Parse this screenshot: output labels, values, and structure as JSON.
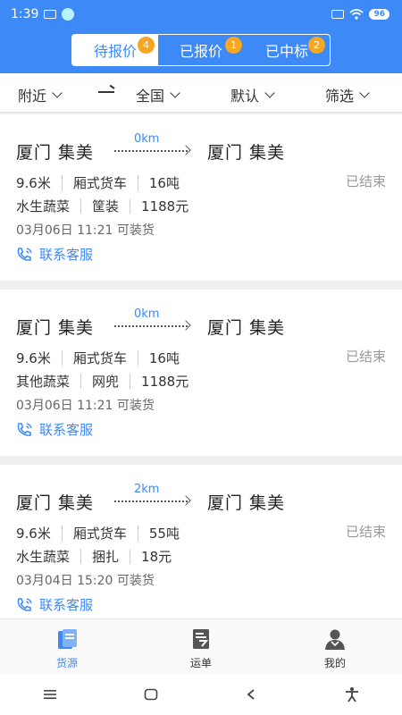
{
  "status_bar": {
    "time": "1:39",
    "battery": "96"
  },
  "tabs": [
    {
      "label": "待报价",
      "badge": "4"
    },
    {
      "label": "已报价",
      "badge": "1"
    },
    {
      "label": "已中标",
      "badge": "2"
    }
  ],
  "filters": {
    "nearby": "附近",
    "region": "全国",
    "sort": "默认",
    "filter": "筛选"
  },
  "cards": [
    {
      "origin": "厦门 集美",
      "destination": "厦门 集美",
      "distance": "0km",
      "length": "9.6米",
      "truck_type": "厢式货车",
      "weight": "16吨",
      "goods": "水生蔬菜",
      "packaging": "筐装",
      "price": "1188元",
      "load_time": "03月06日 11:21 可装货",
      "status": "已结束",
      "contact": "联系客服"
    },
    {
      "origin": "厦门 集美",
      "destination": "厦门 集美",
      "distance": "0km",
      "length": "9.6米",
      "truck_type": "厢式货车",
      "weight": "16吨",
      "goods": "其他蔬菜",
      "packaging": "网兜",
      "price": "1188元",
      "load_time": "03月06日 11:21 可装货",
      "status": "已结束",
      "contact": "联系客服"
    },
    {
      "origin": "厦门 集美",
      "destination": "厦门 集美",
      "distance": "2km",
      "length": "9.6米",
      "truck_type": "厢式货车",
      "weight": "55吨",
      "goods": "水生蔬菜",
      "packaging": "捆扎",
      "price": "18元",
      "load_time": "03月04日 15:20 可装货",
      "status": "已结束",
      "contact": "联系客服"
    }
  ],
  "bottom_tabs": [
    {
      "label": "货源"
    },
    {
      "label": "运单"
    },
    {
      "label": "我的"
    }
  ],
  "colors": {
    "primary": "#3d8af7",
    "badge": "#f5a623"
  }
}
